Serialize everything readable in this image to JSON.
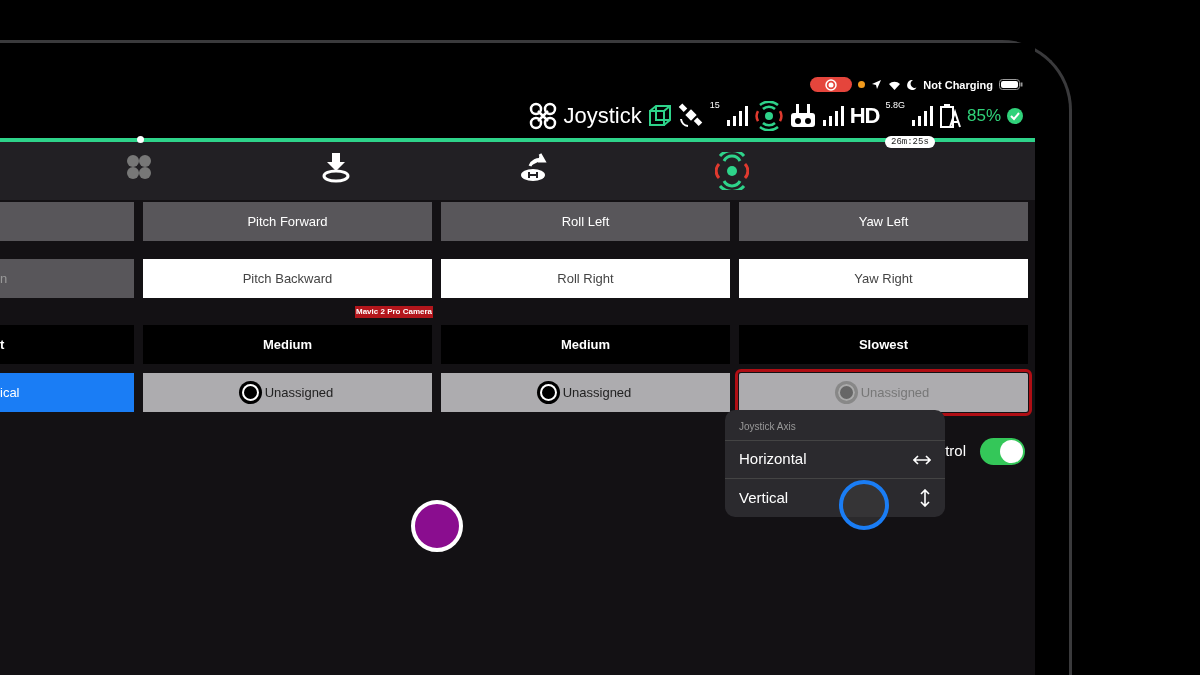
{
  "system_status": {
    "recording": true,
    "charging_text": "Not Charging"
  },
  "telemetry": {
    "mode": "Joystick",
    "satellites": "15",
    "video_label": "HD",
    "video_band": "5.8G",
    "battery": "85%"
  },
  "flight_timeline": {
    "level": 0.13,
    "time": "26m:25s"
  },
  "toolbar_buttons": [
    {
      "kind": "motors",
      "disabled": true
    },
    {
      "kind": "land",
      "disabled": false
    },
    {
      "kind": "return_home",
      "disabled": false
    },
    {
      "kind": "radar",
      "disabled": false
    }
  ],
  "columns": [
    {
      "negative": {
        "label": "n",
        "highlighted": false
      },
      "speed": "t",
      "axis": {
        "label": "ical",
        "assigned": true,
        "focused": false
      }
    },
    {
      "positive": "Pitch Forward",
      "negative": {
        "label": "Pitch Backward",
        "highlighted": true
      },
      "speed": "Medium",
      "axis": {
        "label": "Unassigned",
        "assigned": false,
        "focused": false
      }
    },
    {
      "positive": "Roll Left",
      "negative": {
        "label": "Roll Right",
        "highlighted": true
      },
      "speed": "Medium",
      "axis": {
        "label": "Unassigned",
        "assigned": false,
        "focused": false
      }
    },
    {
      "positive": "Yaw Left",
      "negative": {
        "label": "Yaw Right",
        "highlighted": true
      },
      "speed": "Slowest",
      "axis": {
        "label": "Unassigned",
        "assigned": false,
        "focused": true
      }
    }
  ],
  "camera_label": "Mavic 2 Pro Camera",
  "setting_row": {
    "label": "trol",
    "on": true
  },
  "axis_menu": {
    "title": "Joystick Axis",
    "items": [
      {
        "label": "Horizontal",
        "kind": "horizontal"
      },
      {
        "label": "Vertical",
        "kind": "vertical"
      }
    ]
  }
}
